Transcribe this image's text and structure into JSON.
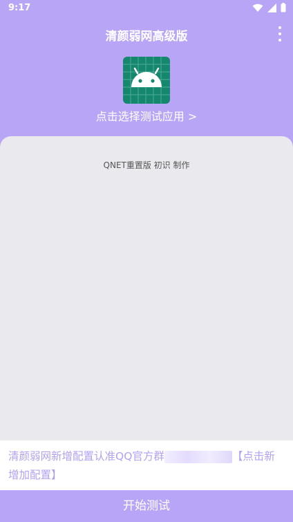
{
  "status_bar": {
    "time": "9:17"
  },
  "app_bar": {
    "title": "清颜弱网高级版",
    "menu_icon": "more-vert-icon"
  },
  "app_selector": {
    "icon": "android-icon",
    "label": "点击选择测试应用 >"
  },
  "panel": {
    "credit": "QNET重置版 初识 制作"
  },
  "notice": {
    "text_before": "清颜弱网新增配置认准QQ官方群",
    "text_after": "【点击新增加配置】"
  },
  "start_button": {
    "label": "开始测试"
  },
  "colors": {
    "accent": "#b9a5f6",
    "panel_bg": "#e9e9ee",
    "app_icon_bg": "#15876f",
    "notice_text": "#b3a1f0"
  }
}
